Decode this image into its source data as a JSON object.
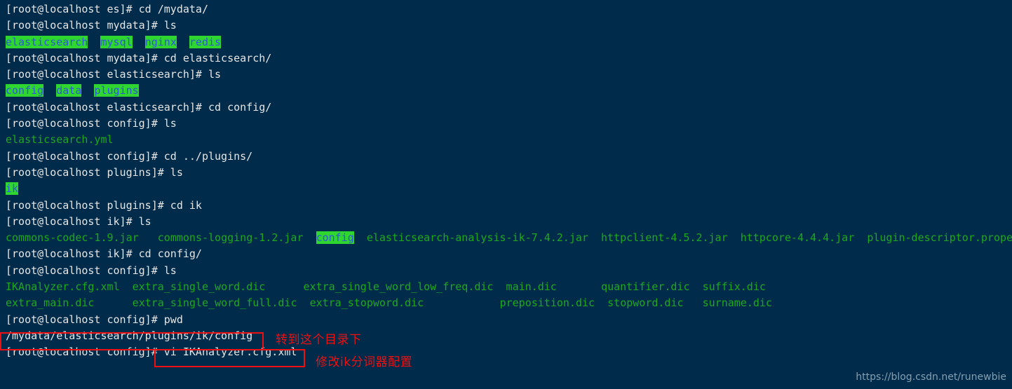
{
  "terminal": {
    "background_color": "#002b4a",
    "prompt_color": "#e6e6e6",
    "file_color": "#1fa81f",
    "dir_text_color": "#2d57d8",
    "dir_bg_color": "#2fd62f",
    "annotation_color": "#ee1111",
    "lines": [
      {
        "type": "prompt",
        "text": "[root@localhost es]# cd /mydata/"
      },
      {
        "type": "prompt",
        "text": "[root@localhost mydata]# ls"
      },
      {
        "type": "listing",
        "cells": [
          {
            "kind": "dir",
            "text": "elasticsearch"
          },
          {
            "kind": "file",
            "text": "mysql",
            "dircolor": true
          },
          {
            "kind": "file",
            "text": "nginx",
            "dircolor": true
          },
          {
            "kind": "file",
            "text": "redis",
            "dircolor": true
          }
        ]
      },
      {
        "type": "prompt",
        "text": "[root@localhost mydata]# cd elasticsearch/"
      },
      {
        "type": "prompt",
        "text": "[root@localhost elasticsearch]# ls"
      },
      {
        "type": "listing",
        "cells": [
          {
            "kind": "dir",
            "text": "config"
          },
          {
            "kind": "dir",
            "text": "data"
          },
          {
            "kind": "dir",
            "text": "plugins"
          }
        ]
      },
      {
        "type": "prompt",
        "text": "[root@localhost elasticsearch]# cd config/"
      },
      {
        "type": "prompt",
        "text": "[root@localhost config]# ls"
      },
      {
        "type": "listing",
        "cells": [
          {
            "kind": "file",
            "text": "elasticsearch.yml"
          }
        ]
      },
      {
        "type": "prompt",
        "text": "[root@localhost config]# cd ../plugins/"
      },
      {
        "type": "prompt",
        "text": "[root@localhost plugins]# ls"
      },
      {
        "type": "listing",
        "cells": [
          {
            "kind": "dir",
            "text": "ik"
          }
        ]
      },
      {
        "type": "prompt",
        "text": "[root@localhost plugins]# cd ik"
      },
      {
        "type": "prompt",
        "text": "[root@localhost ik]# ls"
      },
      {
        "type": "listing",
        "cells": [
          {
            "kind": "file",
            "text": "commons-codec-1.9.jar"
          },
          {
            "kind": "file",
            "text": "commons-logging-1.2.jar"
          },
          {
            "kind": "dir",
            "text": "config"
          },
          {
            "kind": "file",
            "text": "elasticsearch-analysis-ik-7.4.2.jar"
          },
          {
            "kind": "file",
            "text": "httpclient-4.5.2.jar"
          },
          {
            "kind": "file",
            "text": "httpcore-4.4.4.jar"
          },
          {
            "kind": "file",
            "text": "plugin-descriptor.properties"
          }
        ]
      },
      {
        "type": "prompt",
        "text": "[root@localhost ik]# cd config/"
      },
      {
        "type": "prompt",
        "text": "[root@localhost config]# ls"
      },
      {
        "type": "listing",
        "cells": [
          {
            "kind": "file",
            "text": "IKAnalyzer.cfg.xml"
          },
          {
            "kind": "file",
            "text": "extra_single_word.dic"
          },
          {
            "kind": "file",
            "text": "extra_single_word_low_freq.dic"
          },
          {
            "kind": "file",
            "text": "main.dic"
          },
          {
            "kind": "file",
            "text": "quantifier.dic"
          },
          {
            "kind": "file",
            "text": "suffix.dic"
          }
        ]
      },
      {
        "type": "listing",
        "cells": [
          {
            "kind": "file",
            "text": "extra_main.dic"
          },
          {
            "kind": "file",
            "text": "extra_single_word_full.dic"
          },
          {
            "kind": "file",
            "text": "extra_stopword.dic"
          },
          {
            "kind": "file",
            "text": "preposition.dic"
          },
          {
            "kind": "file",
            "text": "stopword.dic"
          },
          {
            "kind": "file",
            "text": "surname.dic"
          }
        ]
      },
      {
        "type": "prompt",
        "text": "[root@localhost config]# pwd"
      },
      {
        "type": "prompt",
        "text": "/mydata/elasticsearch/plugins/ik/config"
      },
      {
        "type": "prompt",
        "text": "[root@localhost config]# vi IKAnalyzer.cfg.xml"
      }
    ]
  },
  "annotations": {
    "pwd_note": "转到这个目录下",
    "vi_note": "修改ik分词器配置"
  },
  "watermark": {
    "url": "https://blog.csdn.net/runewbie"
  }
}
